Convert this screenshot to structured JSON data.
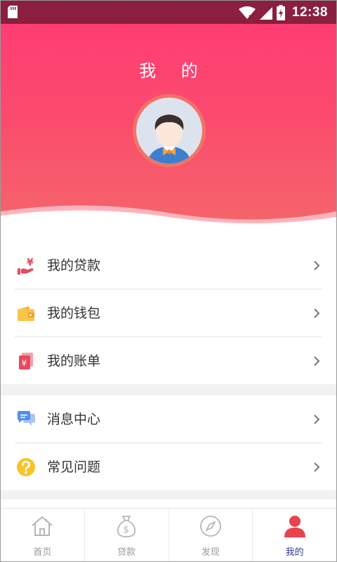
{
  "status_bar": {
    "time": "12:38"
  },
  "header": {
    "title": "我 的"
  },
  "menu": {
    "group1": [
      {
        "label": "我的贷款",
        "icon": "loan-hand-yuan-icon"
      },
      {
        "label": "我的钱包",
        "icon": "wallet-icon"
      },
      {
        "label": "我的账单",
        "icon": "bill-icon"
      }
    ],
    "group2": [
      {
        "label": "消息中心",
        "icon": "chat-bubbles-icon"
      },
      {
        "label": "常见问题",
        "icon": "question-icon"
      }
    ]
  },
  "tabs": [
    {
      "label": "首页",
      "icon": "home-icon",
      "active": false
    },
    {
      "label": "贷款",
      "icon": "money-bag-icon",
      "active": false
    },
    {
      "label": "发现",
      "icon": "compass-icon",
      "active": false
    },
    {
      "label": "我的",
      "icon": "person-icon",
      "active": true
    }
  ],
  "colors": {
    "header_top": "#ff3d73",
    "header_bottom": "#f4686a",
    "status_bar": "#8a1f3f",
    "active_tab": "#2b3d8c"
  }
}
